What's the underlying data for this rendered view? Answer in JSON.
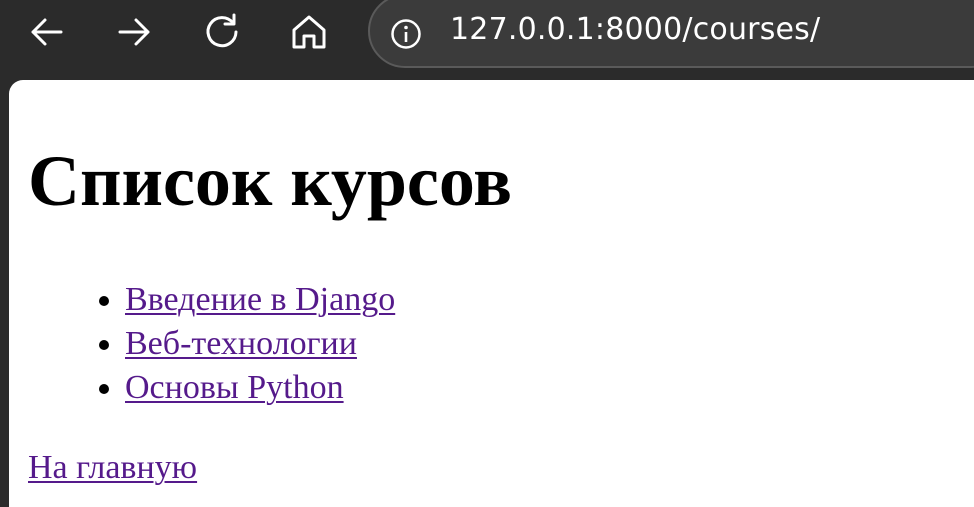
{
  "browser": {
    "url": "127.0.0.1:8000/courses/",
    "icons": [
      "back-arrow-icon",
      "forward-arrow-icon",
      "reload-icon",
      "home-icon",
      "info-icon"
    ]
  },
  "page": {
    "title": "Список курсов",
    "courses": [
      {
        "label": "Введение в Django"
      },
      {
        "label": "Веб-технологии"
      },
      {
        "label": "Основы Python"
      }
    ],
    "home_link": "На главную"
  },
  "colors": {
    "toolbar": "#2b2b2b",
    "link_visited": "#551a8b"
  }
}
